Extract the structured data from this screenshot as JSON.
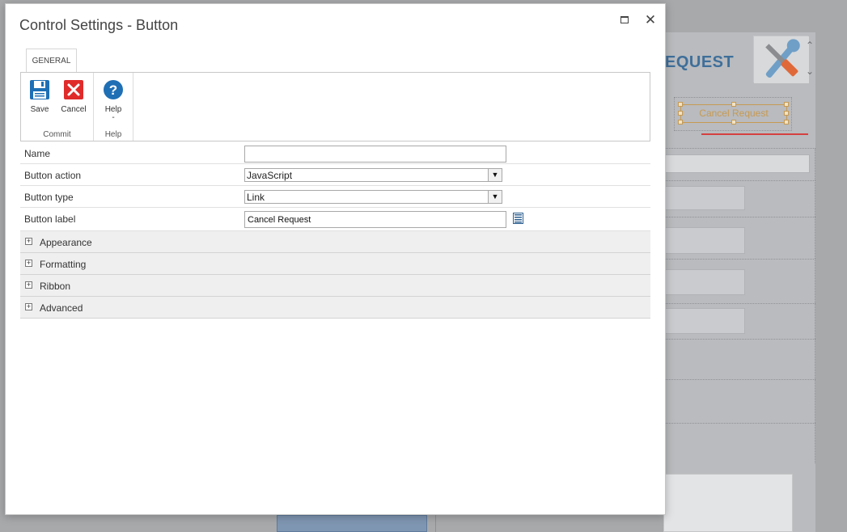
{
  "background": {
    "form_title": "EQUEST",
    "selected_button_label": "Cancel Request"
  },
  "dialog": {
    "title": "Control Settings - Button",
    "maximize_icon": "maximize-icon",
    "close_icon": "close-icon",
    "close_glyph": "✕"
  },
  "tabs": [
    {
      "label": "GENERAL",
      "active": true
    }
  ],
  "ribbon": {
    "groups": [
      {
        "label": "Commit",
        "buttons": [
          {
            "label": "Save",
            "icon": "save-icon"
          },
          {
            "label": "Cancel",
            "icon": "cancel-icon"
          }
        ]
      },
      {
        "label": "Help",
        "buttons": [
          {
            "label": "Help",
            "icon": "help-icon",
            "dropdown_marker": "-"
          }
        ]
      }
    ]
  },
  "properties": {
    "name": {
      "label": "Name",
      "value": ""
    },
    "button_action": {
      "label": "Button action",
      "value": "JavaScript"
    },
    "button_type": {
      "label": "Button type",
      "value": "Link"
    },
    "button_label": {
      "label": "Button label",
      "value": "Cancel Request",
      "side_icon": "document-icon"
    }
  },
  "sections": [
    {
      "label": "Appearance",
      "expanded": false
    },
    {
      "label": "Formatting",
      "expanded": false
    },
    {
      "label": "Ribbon",
      "expanded": false
    },
    {
      "label": "Advanced",
      "expanded": false
    }
  ],
  "colors": {
    "accent_blue": "#1f6fb5",
    "cancel_red": "#e02b2b",
    "background_grey": "#a7a9ab",
    "selected_outline": "#c79a53"
  }
}
